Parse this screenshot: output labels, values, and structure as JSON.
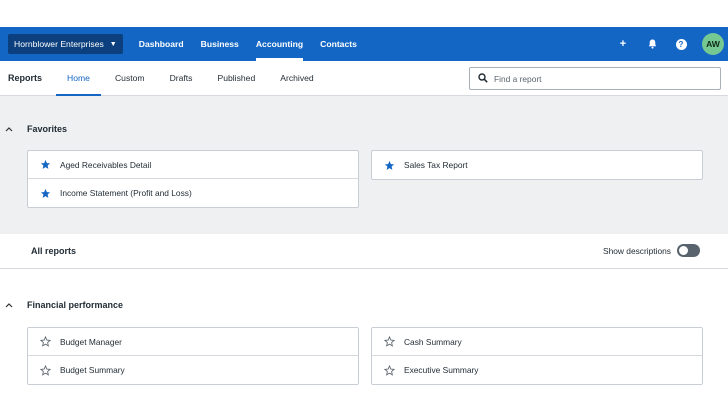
{
  "navbar": {
    "org_name": "Hornblower Enterprises",
    "links": [
      "Dashboard",
      "Business",
      "Accounting",
      "Contacts"
    ],
    "active_link": "Accounting",
    "avatar_initials": "AW",
    "add_glyph": "+",
    "help_glyph": "?"
  },
  "subnav": {
    "title": "Reports",
    "tabs": [
      "Home",
      "Custom",
      "Drafts",
      "Published",
      "Archived"
    ],
    "active_tab": "Home",
    "search_placeholder": "Find a report"
  },
  "favorites": {
    "heading": "Favorites",
    "left": [
      "Aged Receivables Detail",
      "Income Statement (Profit and Loss)"
    ],
    "right": [
      "Sales Tax Report"
    ]
  },
  "all_reports": {
    "heading": "All reports",
    "toggle_label": "Show descriptions",
    "toggle_on": false
  },
  "financial": {
    "heading": "Financial performance",
    "left": [
      "Budget Manager",
      "Budget Summary"
    ],
    "right": [
      "Cash Summary",
      "Executive Summary"
    ]
  },
  "colors": {
    "brand": "#1366c4",
    "org_switcher": "#0c3f7d",
    "avatar": "#76c893",
    "favorites_bg": "#eef0f2",
    "star_filled": "#1366c4"
  },
  "icons": {
    "search": "search-icon",
    "add": "plus-icon",
    "notifications": "bell-icon",
    "help": "help-icon",
    "chevron": "chevron-up-icon",
    "favorite": "star-filled-icon",
    "unfavorite": "star-outline-icon"
  }
}
